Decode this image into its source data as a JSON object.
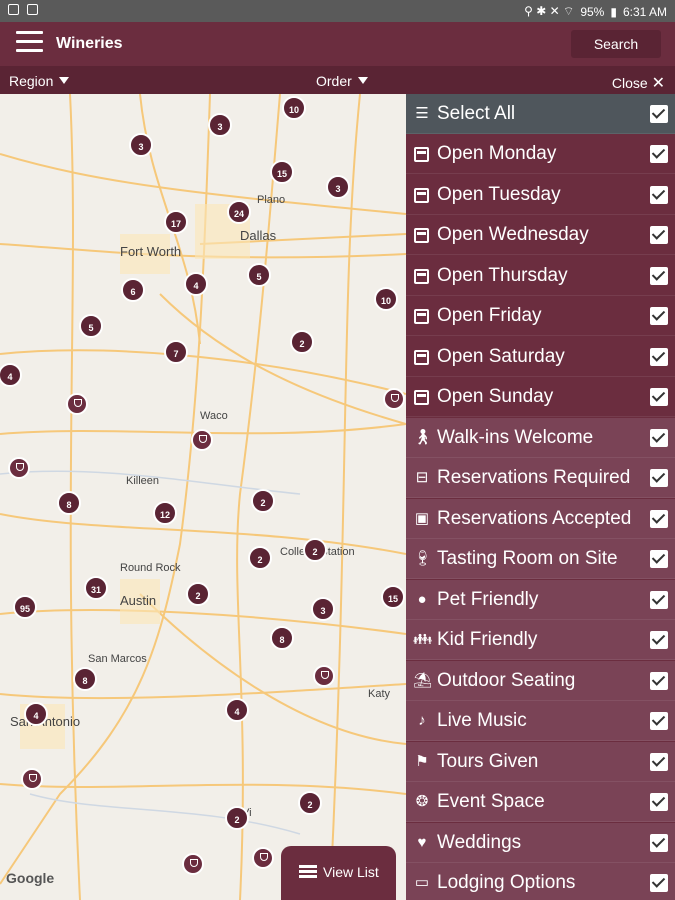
{
  "status_bar": {
    "time": "6:31 AM",
    "battery": "95%"
  },
  "app_bar": {
    "title": "Wineries",
    "search_label": "Search"
  },
  "filter_bar": {
    "region_label": "Region",
    "order_label": "Order",
    "close_label": "Close"
  },
  "map": {
    "google_label": "Google",
    "cities": {
      "fort_worth": "Fort Worth",
      "dallas": "Dallas",
      "plano": "Plano",
      "waco": "Waco",
      "killeen": "Killeen",
      "round_rock": "Round Rock",
      "austin": "Austin",
      "college_station": "College Station",
      "san_marcos": "San Marcos",
      "san_antonio": "San Antonio",
      "katy": "Katy",
      "victoria": "Vi"
    },
    "clusters": [
      "10",
      "3",
      "3",
      "15",
      "3",
      "17",
      "24",
      "6",
      "4",
      "5",
      "10",
      "5",
      "7",
      "2",
      "4",
      "8",
      "12",
      "2",
      "2",
      "2",
      "31",
      "2",
      "95",
      "3",
      "15",
      "8",
      "8",
      "4",
      "4",
      "2",
      "2"
    ],
    "view_list_label": "View List"
  },
  "filters": {
    "select_all": "Select All",
    "days": [
      "Open Monday",
      "Open Tuesday",
      "Open Wednesday",
      "Open Thursday",
      "Open Friday",
      "Open Saturday",
      "Open Sunday"
    ],
    "features": [
      "Walk-ins Welcome",
      "Reservations Required",
      "Reservations Accepted",
      "Tasting Room on Site",
      "Pet Friendly",
      "Kid Friendly",
      "Outdoor Seating",
      "Live Music",
      "Tours Given",
      "Event Space",
      "Weddings",
      "Lodging Options"
    ]
  },
  "colors": {
    "primary": "#6b2d3f",
    "dark": "#5a2434",
    "feature_row": "#7a4356",
    "select_all_row": "#4f565c"
  }
}
